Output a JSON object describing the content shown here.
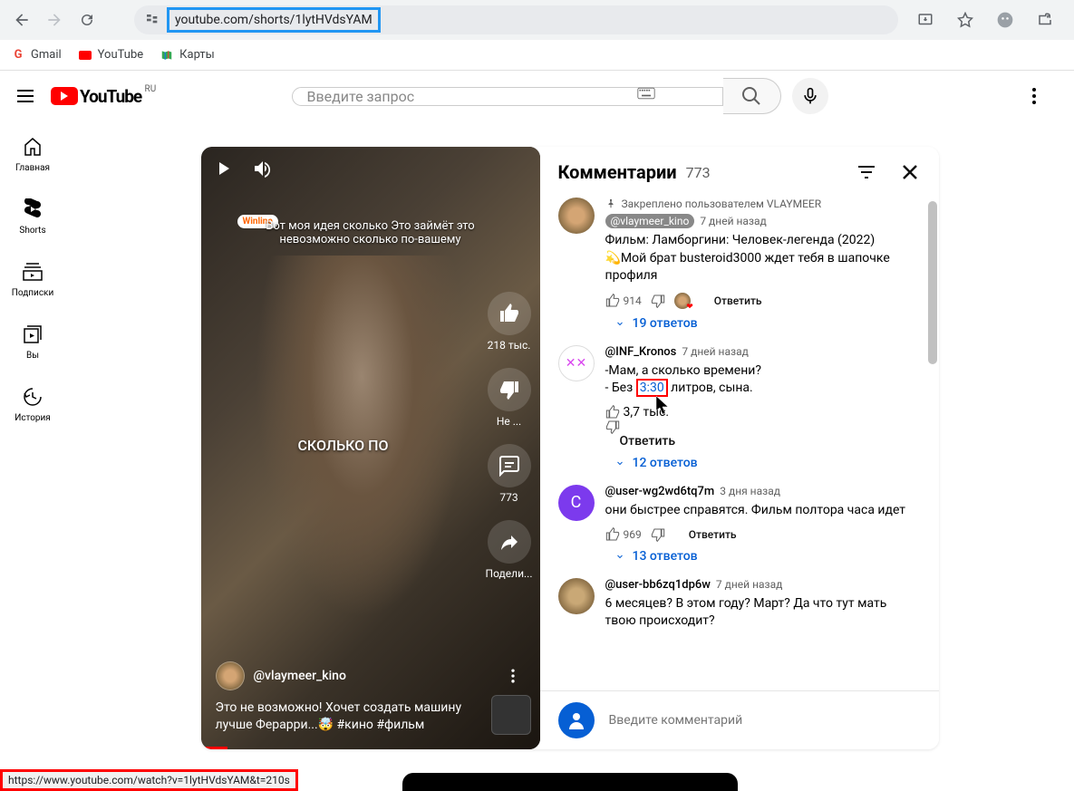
{
  "browser": {
    "url": "youtube.com/shorts/1lytHVdsYAM",
    "bookmarks": [
      {
        "label": "Gmail",
        "icon": "G"
      },
      {
        "label": "YouTube"
      },
      {
        "label": "Карты"
      }
    ]
  },
  "header": {
    "region": "RU",
    "search_placeholder": "Введите запрос"
  },
  "sidebar": {
    "items": [
      {
        "label": "Главная"
      },
      {
        "label": "Shorts"
      },
      {
        "label": "Подписки"
      },
      {
        "label": "Вы"
      },
      {
        "label": "История"
      }
    ]
  },
  "video": {
    "winline": "Winline",
    "caption": "Вот моя идея сколько Это займёт это невозможно сколько по-вашему",
    "subtitle": "СКОЛЬКО ПО",
    "channel": "@vlaymeer_kino",
    "title": "Это не возможно! Хочет создать машину лучше Ферарри...🤯 #кино #фильм",
    "actions": {
      "likes": "218 тыс.",
      "dislike": "Не ...",
      "comments_count": "773",
      "share": "Подели..."
    }
  },
  "comments": {
    "title": "Комментарии",
    "count": "773",
    "pinned_by": "Закреплено пользователем VLAYMEER",
    "input_placeholder": "Введите комментарий",
    "list": [
      {
        "author": "@vlaymeer_kino",
        "author_chip": true,
        "time": "7 дней назад",
        "text": "Фильм: Ламборгини: Человек-легенда (2022)\n💫Мой брат busteroid3000 ждет тебя в шапочке профиля",
        "likes": "914",
        "hearted": true,
        "reply_label": "Ответить",
        "replies": "19 ответов"
      },
      {
        "author": "@INF_Kronos",
        "time": "7 дней назад",
        "text_pre": "-Мам, а сколько времени?\n- Без ",
        "timestamp": "3:30",
        "text_post": " литров, сына.",
        "likes": "3,7 тыс.",
        "reply_label": "Ответить",
        "replies": "12 ответов"
      },
      {
        "author": "@user-wg2wd6tq7m",
        "time": "3 дня назад",
        "text": "они быстрее справятся. Фильм полтора часа идет",
        "likes": "969",
        "reply_label": "Ответить",
        "replies": "13 ответов"
      },
      {
        "author": "@user-bb6zq1dp6w",
        "time": "7 дней назад",
        "text": "6 месяцев? В этом году? Март? Да что тут мать твою происходит?"
      }
    ]
  },
  "status_url": "https://www.youtube.com/watch?v=1lytHVdsYAM&t=210s"
}
